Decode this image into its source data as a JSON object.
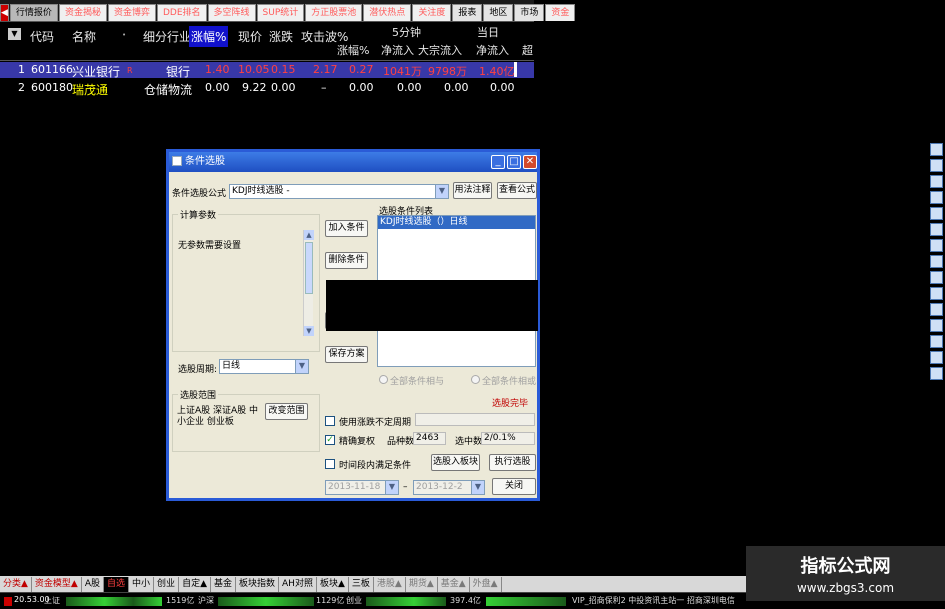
{
  "top_tabs": [
    "行情报价",
    "资金揭秘",
    "资金博弈",
    "DDE排名",
    "多空阵线",
    "SUP统计",
    "方正股票池",
    "潜伏热点",
    "关注度",
    "报表",
    "地区",
    "市场",
    "资金"
  ],
  "table": {
    "header": {
      "code": "代码",
      "name": "名称",
      "industry": "细分行业",
      "change_pct": "涨幅%",
      "price": "现价",
      "change": "涨跌",
      "attack_wave": "攻击波%",
      "group_5min": "5分钟",
      "group_today": "当日",
      "sub_change": "涨幅%",
      "sub_net_in": "净流入",
      "sub_block_in": "大宗流入",
      "sub_net_in2": "净流入",
      "sub_super": "超"
    },
    "rows": [
      {
        "idx": "1",
        "code": "601166",
        "name": "兴业银行",
        "mark": "R",
        "industry": "银行",
        "change_pct": "1.40",
        "price": "10.05",
        "change": "0.15",
        "attack": "2.17",
        "m5_change": "0.27",
        "m5_net_in": "1041万",
        "block_in": "9798万",
        "today_net_in": "1.40亿"
      },
      {
        "idx": "2",
        "code": "600180",
        "name": "瑞茂通",
        "mark": "",
        "industry": "仓储物流",
        "change_pct": "0.00",
        "price": "9.22",
        "change": "0.00",
        "attack": "–",
        "m5_change": "0.00",
        "m5_net_in": "0.00",
        "block_in": "0.00",
        "today_net_in": "0.00"
      }
    ]
  },
  "dialog": {
    "title": "条件选股",
    "formula_label": "条件选股公式",
    "formula_value": "KDJ时线选股 -",
    "btn_usage": "用法注释",
    "btn_view_formula": "查看公式",
    "params_group": "计算参数",
    "params_text": "无参数需要设置",
    "btn_add": "加入条件",
    "btn_delete": "删除条件",
    "btn_save": "保存方案",
    "cond_list_label": "选股条件列表",
    "cond_list_items": [
      "KDJ时线选股（）日线"
    ],
    "period_label": "选股周期:",
    "period_value": "日线",
    "radio_all_and": "全部条件相与",
    "radio_all_or": "全部条件相或",
    "status_text": "选股完毕",
    "range_group": "选股范围",
    "range_text": "上证A股 深证A股 中小企业 创业板",
    "btn_change_range": "改变范围",
    "chk_unlimited": "使用涨跌不定周期",
    "chk_exact": "精确复权",
    "variety_label": "品种数",
    "variety_value": "2463",
    "selected_label": "选中数",
    "selected_value": "2/0.1%",
    "chk_timerange": "时间段内满足条件",
    "btn_to_block": "选股入板块",
    "btn_execute": "执行选股",
    "date_from": "2013-11-18",
    "date_sep": "–",
    "date_to": "2013-12-2",
    "btn_close": "关闭"
  },
  "bottom_tabs": [
    "分类▲",
    "资金模型▲",
    "A股",
    "自选",
    "中小",
    "创业",
    "自定▲",
    "基金",
    "板块指数",
    "AH对照",
    "板块▲",
    "三板",
    "港股▲",
    "期货▲",
    "基金▲",
    "外盘▲"
  ],
  "status_bar": {
    "sh_index": "20.53.00",
    "sh_label": "上证",
    "amount1": "1519亿",
    "label2": "沪深",
    "amount2": "1129亿",
    "label3": "创业",
    "amount3": "397.4亿",
    "ticker": "VIP_招商保利2 中投资讯主站一 招商深圳电信"
  },
  "watermark": {
    "title": "指标公式网",
    "url": "www.zbgs3.com"
  },
  "colors": {
    "selected_row": "#3838a8",
    "accent_blue": "#2a5bd7",
    "up_red": "#ff4040",
    "price_yellow": "#ffff00"
  }
}
